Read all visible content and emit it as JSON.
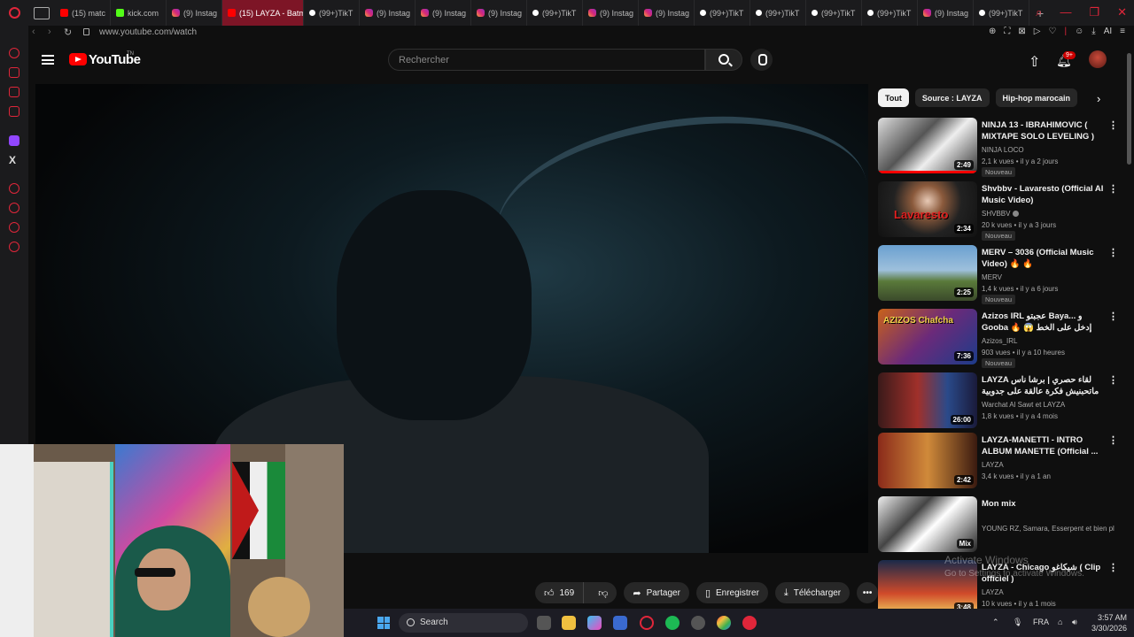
{
  "browser": {
    "tabs": [
      {
        "label": "(15) matc",
        "favicon": "youtube-icon",
        "active": false
      },
      {
        "label": "kick.com",
        "favicon": "kick-icon",
        "active": false
      },
      {
        "label": "(9) Instag",
        "favicon": "instagram-icon",
        "active": false
      },
      {
        "label": "(15) LAYZA - Batm",
        "favicon": "youtube-icon",
        "active": true
      },
      {
        "label": "(99+)TikT",
        "favicon": "tiktok-icon",
        "active": false
      },
      {
        "label": "(9) Instag",
        "favicon": "instagram-icon",
        "active": false
      },
      {
        "label": "(9) Instag",
        "favicon": "instagram-icon",
        "active": false
      },
      {
        "label": "(9) Instag",
        "favicon": "instagram-icon",
        "active": false
      },
      {
        "label": "(99+)TikT",
        "favicon": "tiktok-icon",
        "active": false
      },
      {
        "label": "(9) Instag",
        "favicon": "instagram-icon",
        "active": false
      },
      {
        "label": "(9) Instag",
        "favicon": "instagram-icon",
        "active": false
      },
      {
        "label": "(99+)TikT",
        "favicon": "tiktok-icon",
        "active": false
      },
      {
        "label": "(99+)TikT",
        "favicon": "tiktok-icon",
        "active": false
      },
      {
        "label": "(99+)TikT",
        "favicon": "tiktok-icon",
        "active": false
      },
      {
        "label": "(99+)TikT",
        "favicon": "tiktok-icon",
        "active": false
      },
      {
        "label": "(9) Instag",
        "favicon": "instagram-icon",
        "active": false
      },
      {
        "label": "(99+)TikT",
        "favicon": "tiktok-icon",
        "active": false
      }
    ],
    "url": "www.youtube.com/watch",
    "ai_label": "AI",
    "accent": "#e0263a"
  },
  "youtube": {
    "logo_text": "YouTube",
    "logo_region": "TN",
    "search_placeholder": "Rechercher",
    "notifications_badge": "9+",
    "brand_color": "#ff0000"
  },
  "actions": {
    "likes": "169",
    "share": "Partager",
    "save": "Enregistrer",
    "download": "Télécharger"
  },
  "chips": [
    "Tout",
    "Source : LAYZA",
    "Hip-hop marocain"
  ],
  "recommendations": [
    {
      "title": "NINJA 13 - IBRAHIMOVIC ( MIXTAPE SOLO LEVELING )",
      "channel": "NINJA LOCO",
      "meta": "2,1 k vues • il y a 2 jours",
      "badge": "Nouveau",
      "duration": "2:49",
      "verified": false
    },
    {
      "title": "Shvbbv - Lavaresto (Official AI Music Video)",
      "channel": "SHVBBV",
      "meta": "20 k vues • il y a 3 jours",
      "badge": "Nouveau",
      "duration": "2:34",
      "verified": true,
      "thumb_text": "Lavaresto"
    },
    {
      "title": "MERV – 3036 (Official Music Video) 🔥 🔥",
      "channel": "MERV",
      "meta": "1,4 k vues • il y a 6 jours",
      "badge": "Nouveau",
      "duration": "2:25",
      "verified": false
    },
    {
      "title": "Azizos IRL عجبتو Baya... و Gooba إدخل على الخط 😱 🔥 شوف شصار",
      "channel": "Azizos_IRL",
      "meta": "903 vues • il y a 10 heures",
      "badge": "Nouveau",
      "duration": "7:36",
      "verified": false,
      "thumb_text": "AZIZOS Chafcha"
    },
    {
      "title": "LAYZA لقاء حصري | برشا ناس ماتحبنيش فكرة عالقة على جدوبية",
      "channel": "Warchat Al Sawt et LAYZA",
      "meta": "1,8 k vues • il y a 4 mois",
      "badge": "",
      "duration": "26:00",
      "verified": false
    },
    {
      "title": "LAYZA-MANETTI - INTRO ALBUM MANETTE (Official ...",
      "channel": "LAYZA",
      "meta": "3,4 k vues • il y a 1 an",
      "badge": "",
      "duration": "2:42",
      "verified": false
    },
    {
      "title": "Mon mix",
      "channel": "YOUNG RZ, Samara, Esserpent et bien pl...",
      "meta": "",
      "badge": "",
      "duration": "Mix",
      "verified": false
    },
    {
      "title": "LAYZA - Chicago شيكاغو ( Clip officiel )",
      "channel": "LAYZA",
      "meta": "10 k vues • il y a 1 mois",
      "badge": "",
      "duration": "3:48",
      "verified": false
    }
  ],
  "watermark": {
    "line1": "Activate Windows",
    "line2": "Go to Settings to activate Windows."
  },
  "taskbar": {
    "search_label": "Search",
    "language": "FRA",
    "time": "3:57 AM",
    "date": "3/30/2026"
  }
}
